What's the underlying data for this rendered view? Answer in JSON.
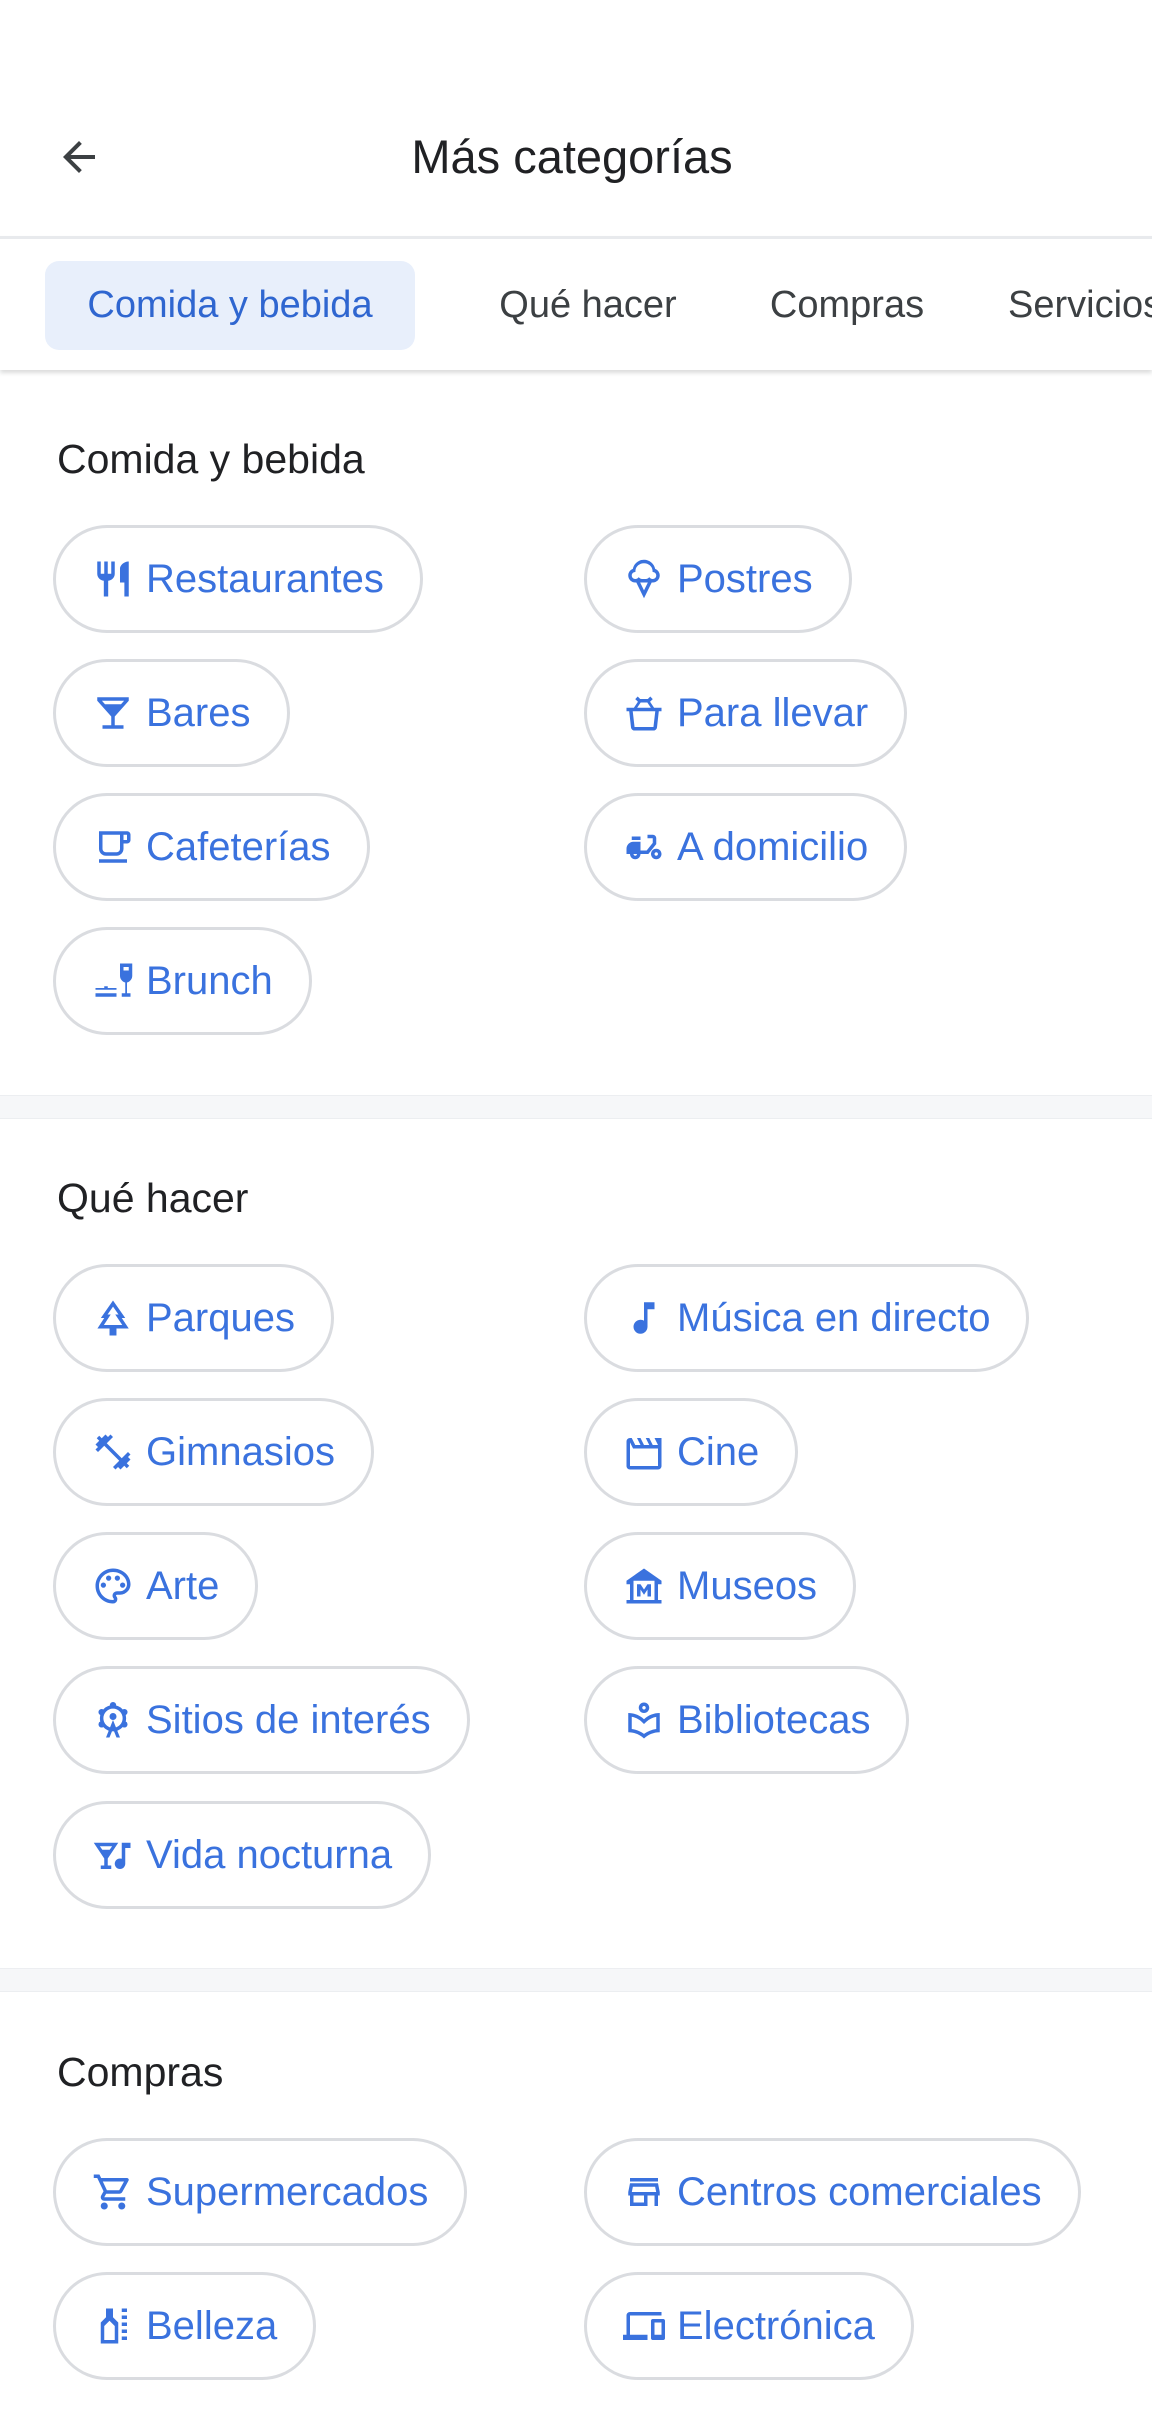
{
  "header": {
    "title": "Más categorías",
    "back_icon": "arrow-back-icon"
  },
  "tabs": [
    {
      "label": "Comida y bebida",
      "active": true
    },
    {
      "label": "Qué hacer",
      "active": false
    },
    {
      "label": "Compras",
      "active": false
    },
    {
      "label": "Servicios",
      "active": false
    }
  ],
  "sections": [
    {
      "title": "Comida y bebida",
      "chips": [
        {
          "label": "Restaurantes",
          "icon": "fork-knife-icon"
        },
        {
          "label": "Postres",
          "icon": "ice-cream-icon"
        },
        {
          "label": "Bares",
          "icon": "cocktail-glass-icon"
        },
        {
          "label": "Para llevar",
          "icon": "takeout-box-icon"
        },
        {
          "label": "Cafeterías",
          "icon": "coffee-cup-icon"
        },
        {
          "label": "A domicilio",
          "icon": "delivery-scooter-icon"
        },
        {
          "label": "Brunch",
          "icon": "brunch-icon"
        }
      ]
    },
    {
      "title": "Qué hacer",
      "chips": [
        {
          "label": "Parques",
          "icon": "tree-icon"
        },
        {
          "label": "Música en directo",
          "icon": "music-note-icon"
        },
        {
          "label": "Gimnasios",
          "icon": "dumbbell-icon"
        },
        {
          "label": "Cine",
          "icon": "clapperboard-icon"
        },
        {
          "label": "Arte",
          "icon": "palette-icon"
        },
        {
          "label": "Museos",
          "icon": "museum-icon"
        },
        {
          "label": "Sitios de interés",
          "icon": "ferris-wheel-icon"
        },
        {
          "label": "Bibliotecas",
          "icon": "library-reader-icon"
        },
        {
          "label": "Vida nocturna",
          "icon": "nightlife-icon"
        }
      ]
    },
    {
      "title": "Compras",
      "chips": [
        {
          "label": "Supermercados",
          "icon": "shopping-cart-icon"
        },
        {
          "label": "Centros comerciales",
          "icon": "storefront-icon"
        },
        {
          "label": "Belleza",
          "icon": "beauty-bottle-icon"
        },
        {
          "label": "Electrónica",
          "icon": "devices-icon"
        }
      ]
    }
  ],
  "colors": {
    "accent": "#3a72de",
    "active_tab_bg": "#e8effb",
    "chip_border": "#dadce0",
    "text": "#202124"
  }
}
